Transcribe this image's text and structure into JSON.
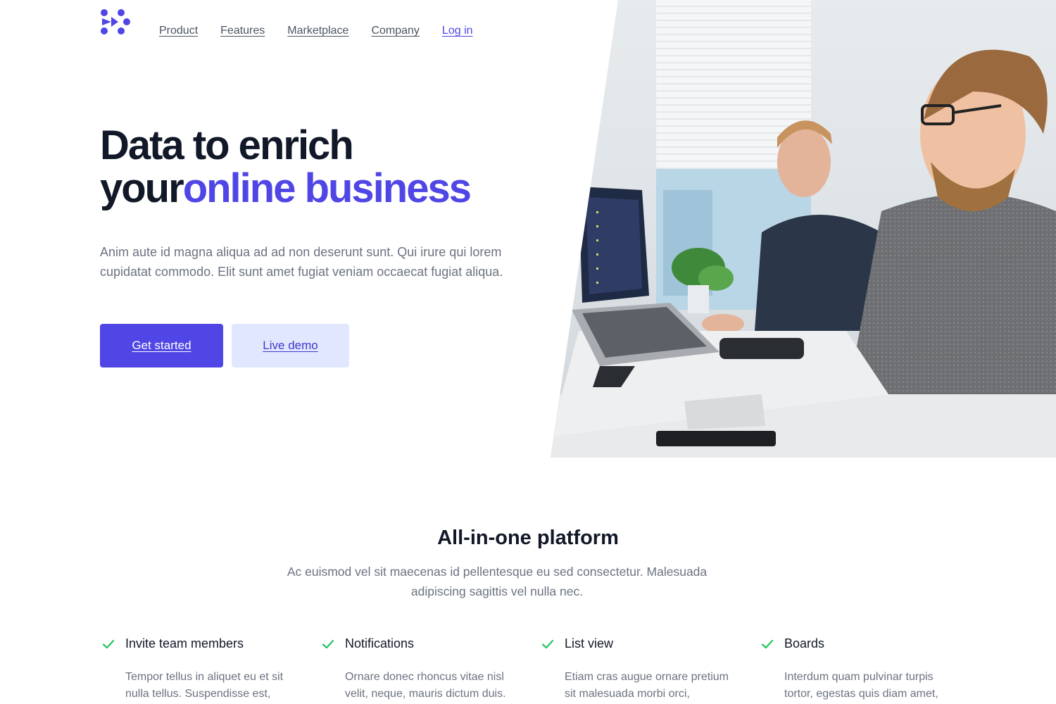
{
  "nav": {
    "items": [
      "Product",
      "Features",
      "Marketplace",
      "Company"
    ],
    "login": "Log in"
  },
  "hero": {
    "title_line1": "Data to enrich",
    "title_line2_plain": "your",
    "title_line2_accent": "online business",
    "description": "Anim aute id magna aliqua ad ad non deserunt sunt. Qui irure qui lorem cupidatat commodo. Elit sunt amet fugiat veniam occaecat fugiat aliqua.",
    "primary_button": "Get started",
    "secondary_button": "Live demo"
  },
  "platform": {
    "title": "All-in-one platform",
    "description": "Ac euismod vel sit maecenas id pellentesque eu sed consectetur. Malesuada adipiscing sagittis vel nulla nec.",
    "features": [
      {
        "name": "Invite team members",
        "description": "Tempor tellus in aliquet eu et sit nulla tellus. Suspendisse est,"
      },
      {
        "name": "Notifications",
        "description": "Ornare donec rhoncus vitae nisl velit, neque, mauris dictum duis."
      },
      {
        "name": "List view",
        "description": "Etiam cras augue ornare pretium sit malesuada morbi orci,"
      },
      {
        "name": "Boards",
        "description": "Interdum quam pulvinar turpis tortor, egestas quis diam amet,"
      }
    ]
  },
  "colors": {
    "brand": "#4f46e5",
    "brand_light": "#e0e7ff",
    "check": "#22c55e",
    "heading": "#111827",
    "body": "#6b7280"
  },
  "icons": {
    "logo": "brand-logo-icon",
    "check": "check-icon"
  }
}
